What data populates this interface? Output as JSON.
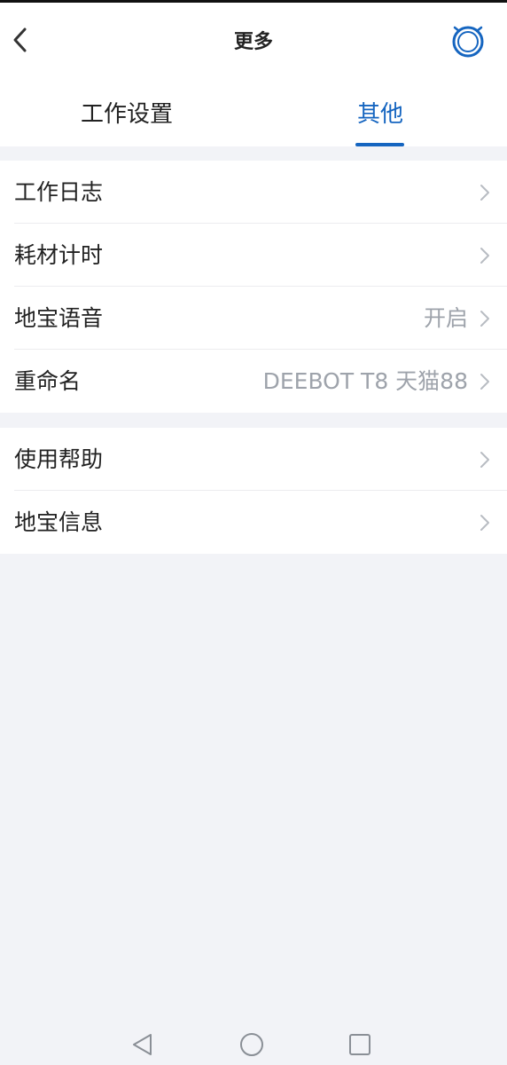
{
  "header": {
    "title": "更多",
    "back_icon": "chevron-left-icon",
    "robot_icon": "robot-icon"
  },
  "tabs": [
    {
      "label": "工作设置",
      "active": false
    },
    {
      "label": "其他",
      "active": true
    }
  ],
  "colors": {
    "accent": "#1565c0",
    "background": "#f2f3f7",
    "secondary_text": "#9ea3ab"
  },
  "groups": [
    {
      "items": [
        {
          "label": "工作日志",
          "value": ""
        },
        {
          "label": "耗材计时",
          "value": ""
        },
        {
          "label": "地宝语音",
          "value": "开启"
        },
        {
          "label": "重命名",
          "value": "DEEBOT T8 天猫88"
        }
      ]
    },
    {
      "items": [
        {
          "label": "使用帮助",
          "value": ""
        },
        {
          "label": "地宝信息",
          "value": ""
        }
      ]
    }
  ],
  "navbar": {
    "icons": [
      "back-triangle-icon",
      "home-circle-icon",
      "recents-square-icon"
    ]
  }
}
